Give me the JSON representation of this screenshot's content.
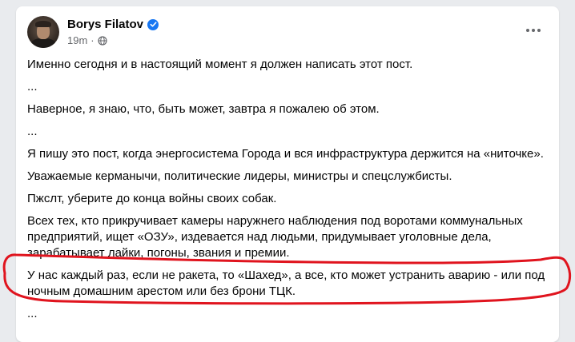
{
  "post": {
    "author": "Borys Filatov",
    "time": "19m",
    "separator": "·",
    "paragraphs": [
      "Именно сегодня и в настоящий момент я должен написать этот пост.",
      "...",
      "Наверное, я знаю, что, быть может, завтра я пожалею об этом.",
      "...",
      "Я пишу это пост, когда энергосистема Города и вся инфраструктура держится на «ниточке».",
      "Уважаемые керманычи, политические лидеры, министры и спецслужбисты.",
      "Пжслт, уберите до конца войны своих собак.",
      "Всех тех, кто прикручивает камеры наружнего наблюдения под воротами коммунальных предприятий, ищет «ОЗУ», издевается над людьми, придумывает уголовные дела, зарабатывает лайки, погоны, звания и премии.",
      "У нас каждый раз, если не ракета,  то «Шахед», а все, кто может устранить аварию - или под ночным домашним арестом или без брони ТЦК.",
      "..."
    ]
  },
  "icons": {
    "verified": "verified-badge-icon",
    "audience": "globe-icon",
    "menu": "more-options-icon"
  },
  "colors": {
    "annotation": "#e0141e",
    "verified": "#1877f2",
    "secondary_text": "#65676b"
  }
}
